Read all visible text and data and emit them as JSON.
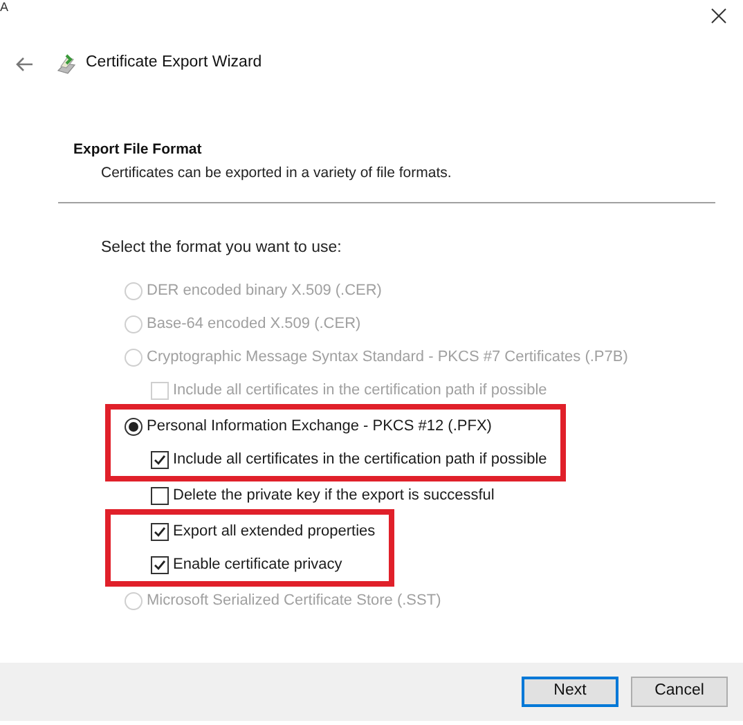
{
  "background_fragment": "A",
  "window": {
    "title": "Certificate Export Wizard"
  },
  "header": {
    "title": "Export File Format",
    "subtitle": "Certificates can be exported in a variety of file formats."
  },
  "prompt": "Select the format you want to use:",
  "groups": [
    {
      "highlighted": false,
      "options": [
        {
          "kind": "radio",
          "label": "DER encoded binary X.509 (.CER)",
          "selected": false,
          "disabled": true
        },
        {
          "kind": "radio",
          "label": "Base-64 encoded X.509 (.CER)",
          "selected": false,
          "disabled": true
        },
        {
          "kind": "radio",
          "label": "Cryptographic Message Syntax Standard - PKCS #7 Certificates (.P7B)",
          "selected": false,
          "disabled": true
        },
        {
          "kind": "checkbox",
          "label": "Include all certificates in the certification path if possible",
          "checked": false,
          "disabled": true
        }
      ]
    },
    {
      "highlighted": true,
      "options": [
        {
          "kind": "radio",
          "label": "Personal Information Exchange - PKCS #12 (.PFX)",
          "selected": true,
          "disabled": false
        },
        {
          "kind": "checkbox",
          "label": "Include all certificates in the certification path if possible",
          "checked": true,
          "disabled": false
        }
      ]
    },
    {
      "highlighted": false,
      "options": [
        {
          "kind": "checkbox",
          "label": "Delete the private key if the export is successful",
          "checked": false,
          "disabled": false
        }
      ]
    },
    {
      "highlighted": true,
      "options": [
        {
          "kind": "checkbox",
          "label": "Export all extended properties",
          "checked": true,
          "disabled": false
        },
        {
          "kind": "checkbox",
          "label": "Enable certificate privacy",
          "checked": true,
          "disabled": false
        }
      ]
    },
    {
      "highlighted": false,
      "options": [
        {
          "kind": "radio",
          "label": "Microsoft Serialized Certificate Store (.SST)",
          "selected": false,
          "disabled": true
        }
      ]
    }
  ],
  "buttons": [
    {
      "label": "Next",
      "default": true
    },
    {
      "label": "Cancel",
      "default": false
    }
  ]
}
